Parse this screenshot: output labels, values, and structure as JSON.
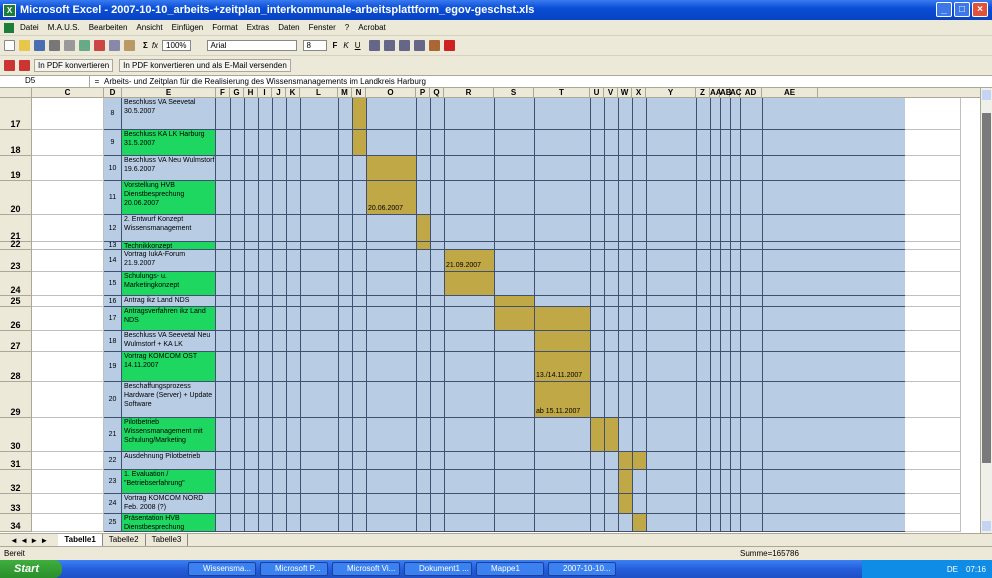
{
  "window": {
    "title": "Microsoft Excel - 2007-10-10_arbeits-+zeitplan_interkommunale-arbeitsplattform_egov-geschst.xls"
  },
  "menu": [
    "Datei",
    "M.A.U.S.",
    "Bearbeiten",
    "Ansicht",
    "Einfügen",
    "Format",
    "Extras",
    "Daten",
    "Fenster",
    "?",
    "Acrobat"
  ],
  "toolbar": {
    "zoom": "100%",
    "font": "Arial",
    "font_size": "8"
  },
  "pdf": {
    "convert": "In PDF konvertieren",
    "convert_mail": "In PDF konvertieren und als E-Mail versenden"
  },
  "formula_bar": {
    "cell": "D5",
    "fx": "=",
    "content": "Arbeits- und Zeitplan für die Realisierung des Wissensmanagements im Landkreis Harburg"
  },
  "columns": [
    "C",
    "D",
    "E",
    "F",
    "G",
    "H",
    "I",
    "J",
    "K",
    "L",
    "M",
    "N",
    "O",
    "P",
    "Q",
    "R",
    "S",
    "T",
    "U",
    "V",
    "W",
    "X",
    "Y",
    "Z",
    "AA",
    "AB",
    "AC",
    "AD",
    "AE"
  ],
  "rows": [
    {
      "rn": "17",
      "num": "8",
      "text": "Beschluss VA Seevetal 30.5.2007",
      "green": false,
      "bar": "N",
      "label": ""
    },
    {
      "rn": "18",
      "num": "9",
      "text": "Beschluss KA LK Harburg 31.5.2007",
      "green": true,
      "bar": "N",
      "label": ""
    },
    {
      "rn": "19",
      "num": "10",
      "text": "Beschluss VA Neu Wulmstorf 19.6.2007",
      "green": false,
      "bar": "O",
      "label": ""
    },
    {
      "rn": "20",
      "num": "11",
      "text": "Vorstellung HVB Dienstbesprechung 20.06.2007",
      "green": true,
      "bar": "O",
      "label": "20.06.2007"
    },
    {
      "rn": "21",
      "num": "12",
      "text": "2. Entwurf Konzept Wissensmanagement",
      "green": false,
      "bar": "P",
      "label": ""
    },
    {
      "rn": "22",
      "num": "13",
      "text": "Technikkonzept",
      "green": true,
      "bar": "P",
      "label": ""
    },
    {
      "rn": "23",
      "num": "14",
      "text": "Vortrag IukA-Forum 21.9.2007",
      "green": false,
      "bar": "R",
      "label": "21.09.2007"
    },
    {
      "rn": "24",
      "num": "15",
      "text": "Schulungs- u. Marketingkonzept",
      "green": true,
      "bar": "R",
      "label": ""
    },
    {
      "rn": "25",
      "num": "16",
      "text": "Antrag ikz Land NDS",
      "green": false,
      "bar": "S",
      "label": ""
    },
    {
      "rn": "26",
      "num": "17",
      "text": "Antragsverfahren ikz Land NDS",
      "green": true,
      "bar": "ST",
      "label": ""
    },
    {
      "rn": "27",
      "num": "18",
      "text": "Beschluss VA Seevetal Neu Wulmstorf + KA LK",
      "green": false,
      "bar": "T",
      "label": ""
    },
    {
      "rn": "28",
      "num": "19",
      "text": "Vortrag KOMCOM OST 14.11.2007",
      "green": true,
      "bar": "T",
      "label": "13./14.11.2007"
    },
    {
      "rn": "29",
      "num": "20",
      "text": "Beschaffungsprozess Hardware (Server) + Update Software",
      "green": false,
      "bar": "T",
      "label": "ab 15.11.2007"
    },
    {
      "rn": "30",
      "num": "21",
      "text": "Pilotbetrieb Wissensmanagement mit Schulung/Marketing",
      "green": true,
      "bar": "UV",
      "label": ""
    },
    {
      "rn": "31",
      "num": "22",
      "text": "Ausdehnung Pilotbetrieb",
      "green": false,
      "bar": "WX",
      "label": ""
    },
    {
      "rn": "32",
      "num": "23",
      "text": "1. Evaluation / \"Betriebserfahrung\"",
      "green": true,
      "bar": "W",
      "label": ""
    },
    {
      "rn": "33",
      "num": "24",
      "text": "Vortrag KOMCOM NORD Feb. 2008 (?)",
      "green": false,
      "bar": "W",
      "label": ""
    },
    {
      "rn": "34",
      "num": "25",
      "text": "Präsentation HVB Dienstbesprechung",
      "green": true,
      "bar": "X",
      "label": ""
    }
  ],
  "sheets": [
    "Tabelle1",
    "Tabelle2",
    "Tabelle3"
  ],
  "status": {
    "left": "Bereit",
    "sum": "Summe=165786"
  },
  "taskbar": {
    "start": "Start",
    "items": [
      "Wissensma...",
      "Microsoft P...",
      "Microsoft Vi...",
      "Dokument1 ...",
      "Mappe1",
      "2007-10-10..."
    ],
    "lang": "DE",
    "time": "07:16"
  },
  "colors": {
    "green": "#1ed760",
    "gold": "#c0a846",
    "blue": "#b8cce4"
  }
}
